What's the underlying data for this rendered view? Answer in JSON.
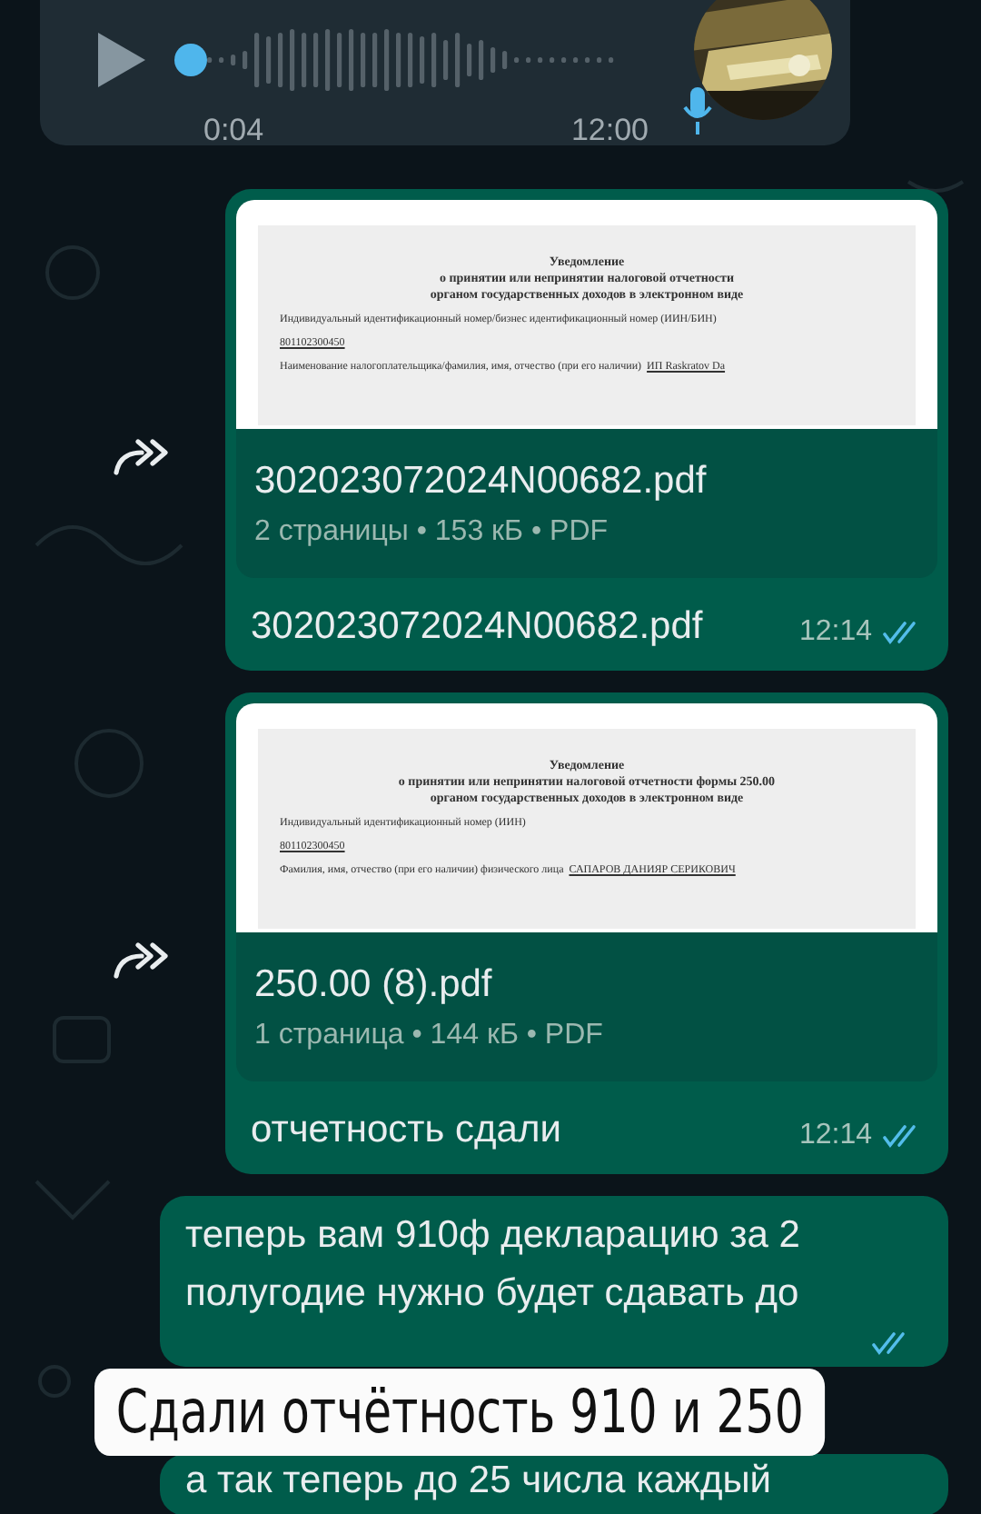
{
  "voice_message": {
    "level": 0,
    "duration": "0:04",
    "time": "12:00"
  },
  "messages": [
    {
      "kind": "document",
      "forwarded": true,
      "preview": {
        "title": [
          "Уведомление",
          "о принятии или непринятии налоговой отчетности",
          "органом государственных доходов в электронном виде"
        ],
        "lines": [
          {
            "label": "Индивидуальный идентификационный номер/бизнес идентификационный номер (ИИН/БИН)"
          },
          {
            "value": "801102300450"
          },
          {
            "label": "Наименование налогоплательщика/фамилия, имя, отчество (при его наличии)",
            "value": "ИП Raskratov Da"
          }
        ]
      },
      "file_name": "302023072024N00682.pdf",
      "file_meta": "2 страницы • 153 кБ • PDF",
      "caption": "302023072024N00682.pdf",
      "time": "12:14",
      "read": true
    },
    {
      "kind": "document",
      "forwarded": true,
      "preview": {
        "title": [
          "Уведомление",
          "о принятии или непринятии налоговой отчетности формы 250.00",
          "органом государственных доходов в электронном виде"
        ],
        "lines": [
          {
            "label": "Индивидуальный идентификационный номер (ИИН)"
          },
          {
            "value": "801102300450"
          },
          {
            "label": "Фамилия, имя, отчество (при его наличии) физического лица",
            "value": "САПАРОВ ДАНИЯР СЕРИКОВИЧ"
          }
        ]
      },
      "file_name": "250.00 (8).pdf",
      "file_meta": "1 страница • 144 кБ • PDF",
      "caption": "отчетность сдали",
      "time": "12:14",
      "read": true
    },
    {
      "kind": "text",
      "lines": [
        "теперь вам 910ф декларацию за 2",
        "полугодие нужно будет сдавать до"
      ],
      "read": true
    },
    {
      "kind": "text",
      "lines": [
        "а так теперь до 25 числа каждый"
      ]
    }
  ],
  "overlay_caption": "Сдали отчётность 910 и 250"
}
